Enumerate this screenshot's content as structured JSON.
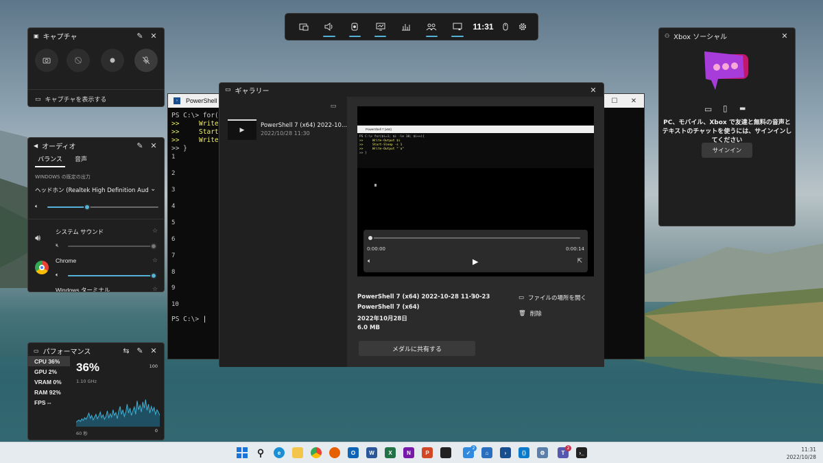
{
  "topbar": {
    "clock": "11:31"
  },
  "capture": {
    "title": "キャプチャ",
    "show_captures": "キャプチャを表示する"
  },
  "audio": {
    "title": "オーディオ",
    "tabs": [
      "バランス",
      "音声"
    ],
    "default_output_label": "WINDOWS の既定の出力",
    "device": "ヘッドホン (Realtek High Definition Audio(...",
    "apps": [
      {
        "name": "システム サウンド",
        "level": 1.0,
        "muted": true
      },
      {
        "name": "Chrome",
        "level": 1.0,
        "muted": false
      },
      {
        "name": "Windows ターミナル"
      }
    ],
    "master_level": 0.36
  },
  "performance": {
    "title": "パフォーマンス",
    "rows": [
      {
        "label": "CPU",
        "value": "36%"
      },
      {
        "label": "GPU",
        "value": "2%"
      },
      {
        "label": "VRAM",
        "value": "0%"
      },
      {
        "label": "RAM",
        "value": "92%"
      },
      {
        "label": "FPS",
        "value": "--"
      }
    ],
    "big_value": "36%",
    "freq": "1.10 GHz",
    "max": "100",
    "min": "0",
    "duration": "60 秒",
    "graph": [
      8,
      10,
      12,
      9,
      14,
      11,
      16,
      13,
      18,
      24,
      15,
      20,
      12,
      17,
      22,
      14,
      19,
      26,
      16,
      21,
      13,
      18,
      28,
      15,
      23,
      17,
      30,
      20,
      25,
      14,
      27,
      36,
      22,
      30,
      18,
      26,
      40,
      24,
      33,
      20,
      28,
      35,
      22,
      46,
      30,
      38,
      26,
      44,
      33,
      48,
      29,
      40,
      24,
      36,
      28,
      34,
      22,
      30,
      26,
      20
    ]
  },
  "xbox": {
    "title": "Xbox ソーシャル",
    "message": "PC、モバイル、Xbox で友達と無料の音声とテキストのチャットを使うには、サインインしてください",
    "signin": "サインイン"
  },
  "terminal": {
    "tab_title": "PowerShell 7 (",
    "lines": [
      "PS C:\\> for($",
      ">>     Write-",
      ">>     Start-",
      ">>     Write-",
      ">> }"
    ],
    "numbers": [
      "1",
      "2",
      "3",
      "4",
      "5",
      "6",
      "7",
      "8",
      "9",
      "10"
    ],
    "prompt": "PS C:\\> "
  },
  "gallery": {
    "title": "ギャラリー",
    "item_title": "PowerShell 7 (x64) 2022-10...",
    "item_date": "2022/10/28 11:30",
    "inner_title": "PowerShell 7 (x64)",
    "inner_lines": [
      "PS C:\\> for($i=1; $i -le 10; $i++){",
      ">>     Write-Output $i",
      ">>     Start-Sleep -s 1",
      ">>     Write-Output \"`a\"",
      ">> }"
    ],
    "time_start": "0:00:00",
    "time_end": "0:00:14",
    "progress": 0.0,
    "file_name": "PowerShell 7 (x64) 2022-10-28 11-30-23",
    "app_name": "PowerShell 7 (x64)",
    "date": "2022年10月28日",
    "size": "6.0 MB",
    "open_location": "ファイルの場所を開く",
    "delete": "削除",
    "share": "メダルに共有する"
  },
  "taskbar": {
    "time": "11:31",
    "date": "2022/10/28",
    "badge1": "2",
    "badge2": "2"
  }
}
